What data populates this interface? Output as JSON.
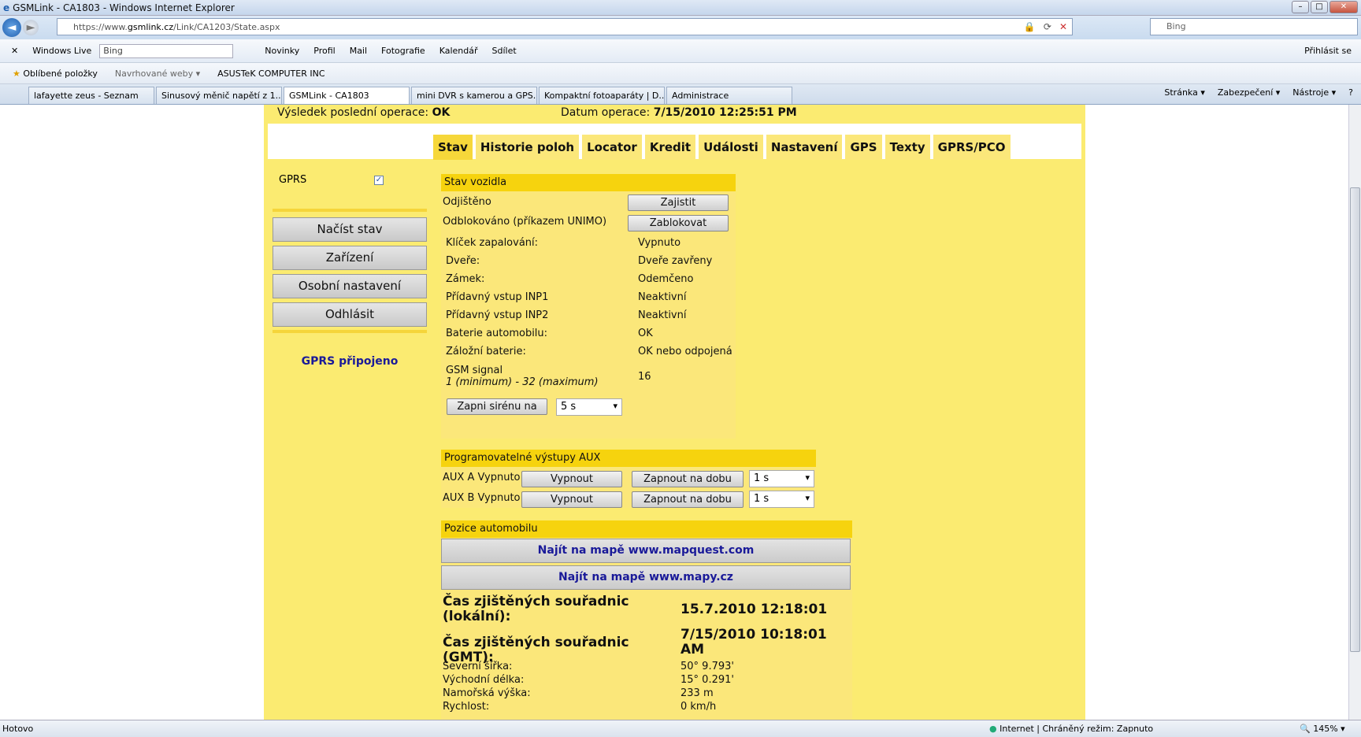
{
  "window": {
    "title": "GSMLink - CA1803 - Windows Internet Explorer"
  },
  "address": {
    "url_prefix": "https://www.",
    "url_domain": "gsmlink.cz",
    "url_path": "/Link/CA1203/State.aspx",
    "search_placeholder": "Bing"
  },
  "livebar": {
    "brand": "Windows Live",
    "search_value": "Bing",
    "items": [
      "Novinky",
      "Profil",
      "Mail",
      "Fotografie",
      "Kalendář",
      "Sdílet"
    ],
    "signin": "Přihlásit se"
  },
  "favbar": {
    "favorites": "Oblíbené položky",
    "suggested": "Navrhované weby ▾",
    "asus": "ASUSTeK COMPUTER INC"
  },
  "tabs": [
    "lafayette zeus - Seznam",
    "Sinusový měnič napětí z 1...",
    "GSMLink - CA1803",
    "mini DVR s kamerou a GPS...",
    "Kompaktní fotoaparáty | D...",
    "Administrace"
  ],
  "tools": {
    "page": "Stránka ▾",
    "security": "Zabezpečení ▾",
    "tools": "Nástroje ▾"
  },
  "status": {
    "left": "Hotovo",
    "zone": "Internet | Chráněný režim: Zapnuto",
    "zoom": "145%"
  },
  "top": {
    "last_op_label": "Výsledek poslední operace:",
    "last_op_value": "OK",
    "date_label": "Datum operace:",
    "date_value": "7/15/2010 12:25:51 PM"
  },
  "nav": [
    "Stav",
    "Historie poloh",
    "Locator",
    "Kredit",
    "Události",
    "Nastavení",
    "GPS",
    "Texty",
    "GPRS/PCO"
  ],
  "left": {
    "gprs_label": "GPRS",
    "buttons": [
      "Načíst stav",
      "Zařízení",
      "Osobní nastavení",
      "Odhlásit"
    ],
    "gprs_status": "GPRS připojeno"
  },
  "vehicle": {
    "title": "Stav vozidla",
    "unlocked": "Odjištěno",
    "lock_btn": "Zajistit",
    "unblocked": "Odblokováno (příkazem UNIMO)",
    "block_btn": "Zablokovat",
    "rows": [
      [
        "Klíček zapalování:",
        "Vypnuto"
      ],
      [
        "Dveře:",
        "Dveře zavřeny"
      ],
      [
        "Zámek:",
        "Odemčeno"
      ],
      [
        "Přídavný vstup INP1",
        "Neaktivní"
      ],
      [
        "Přídavný vstup INP2",
        "Neaktivní"
      ],
      [
        "Baterie automobilu:",
        "OK"
      ],
      [
        "Záložní baterie:",
        "OK nebo odpojená"
      ]
    ],
    "gsm_label": "GSM signal",
    "gsm_range": "1 (minimum) - 32 (maximum)",
    "gsm_value": "16",
    "siren_btn": "Zapni sirénu na",
    "siren_select": "5 s"
  },
  "aux": {
    "title": "Programovatelné výstupy AUX",
    "a_label": "AUX A Vypnuto",
    "b_label": "AUX B Vypnuto",
    "off_btn": "Vypnout",
    "on_btn": "Zapnout na dobu",
    "sel": "1 s"
  },
  "position": {
    "title": "Pozice automobilu",
    "map1": "Najít na mapě www.mapquest.com",
    "map2": "Najít na mapě www.mapy.cz",
    "local_label": "Čas zjištěných souřadnic (lokální):",
    "local_value": "15.7.2010 12:18:01",
    "gmt_label": "Čas zjištěných souřadnic (GMT):",
    "gmt_value": "7/15/2010 10:18:01 AM",
    "rows": [
      [
        "Severní šířka:",
        "50° 9.793'"
      ],
      [
        "Východní délka:",
        "15° 0.291'"
      ],
      [
        "Namořská výška:",
        "233 m"
      ],
      [
        "Rychlost:",
        "0 km/h"
      ]
    ]
  }
}
